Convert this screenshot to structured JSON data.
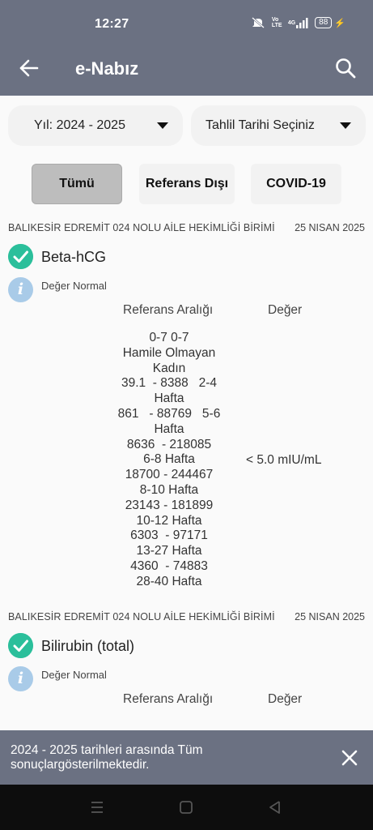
{
  "status_bar": {
    "time": "12:27",
    "network": "Vo LTE",
    "signal": "4G",
    "battery": "88"
  },
  "app_bar": {
    "title": "e-Nabız",
    "back_icon": "arrow-left-icon",
    "search_icon": "search-icon"
  },
  "filters": {
    "year_label": "Yıl: 2024 - 2025",
    "date_label": "Tahlil Tarihi Seçiniz",
    "buttons": [
      {
        "label": "Tümü",
        "selected": true
      },
      {
        "label": "Referans Dışı",
        "selected": false
      },
      {
        "label": "COVID-19",
        "selected": false
      }
    ]
  },
  "results": [
    {
      "institution": "BALIKESİR EDREMİT 024 NOLU AİLE HEKİMLİĞİ BİRİMİ",
      "date": "25 NISAN 2025",
      "test_name": "Beta-hCG",
      "status": "Değer Normal",
      "ref_header": "Referans Aralığı",
      "value_header": "Değer",
      "reference_range": "0-7 0-7\nHamile Olmayan\nKadın\n39.1  - 8388   2-4\nHafta\n861   - 88769   5-6\nHafta\n8636  - 218085\n6-8 Hafta\n18700 - 244467\n8-10 Hafta\n23143 - 181899\n10-12 Hafta\n6303  - 97171\n13-27 Hafta\n4360  - 74883\n28-40 Hafta",
      "value": "< 5.0 mIU/mL"
    },
    {
      "institution": "BALIKESİR EDREMİT 024 NOLU AİLE HEKİMLİĞİ BİRİMİ",
      "date": "25 NISAN 2025",
      "test_name": "Bilirubin (total)",
      "status": "Değer Normal",
      "ref_header": "Referans Aralığı",
      "value_header": "Değer"
    }
  ],
  "snackbar": {
    "message": "2024 - 2025 tarihleri arasında Tüm sonuçlargösterilmektedir."
  },
  "colors": {
    "app_bar": "#6b7182",
    "check": "#2bbf9b",
    "info": "#a9cbe8"
  }
}
